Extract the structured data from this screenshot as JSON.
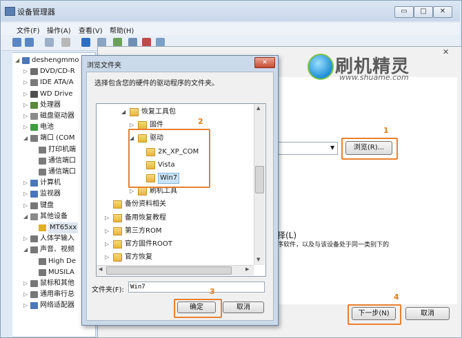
{
  "window": {
    "title": "设备管理器",
    "min": "▭",
    "max": "□",
    "close": "✕"
  },
  "menu": [
    "文件(F)",
    "操作(A)",
    "查看(V)",
    "帮助(H)"
  ],
  "tree": [
    {
      "label": "deshengmmo",
      "indent": 0,
      "exp": "◢",
      "icon": "#4a77b8"
    },
    {
      "label": "DVD/CD-R",
      "indent": 1,
      "exp": "▷",
      "icon": "#6d6d6d"
    },
    {
      "label": "IDE ATA/A",
      "indent": 1,
      "exp": "▷",
      "icon": "#7a7a7a"
    },
    {
      "label": "WD Drive",
      "indent": 1,
      "exp": "▷",
      "icon": "#4f4f4f"
    },
    {
      "label": "处理器",
      "indent": 1,
      "exp": "▷",
      "icon": "#5a8a3a"
    },
    {
      "label": "磁盘驱动器",
      "indent": 1,
      "exp": "▷",
      "icon": "#8a8a8a"
    },
    {
      "label": "电池",
      "indent": 1,
      "exp": "▷",
      "icon": "#3e9c3e"
    },
    {
      "label": "端口 (COM",
      "indent": 1,
      "exp": "◢",
      "icon": "#7b7b7b"
    },
    {
      "label": "打印机端",
      "indent": 2,
      "exp": "",
      "icon": "#7b7b7b"
    },
    {
      "label": "通信端口",
      "indent": 2,
      "exp": "",
      "icon": "#7b7b7b"
    },
    {
      "label": "通信端口",
      "indent": 2,
      "exp": "",
      "icon": "#7b7b7b"
    },
    {
      "label": "计算机",
      "indent": 1,
      "exp": "▷",
      "icon": "#4a77b8"
    },
    {
      "label": "监视器",
      "indent": 1,
      "exp": "▷",
      "icon": "#4a77b8"
    },
    {
      "label": "键盘",
      "indent": 1,
      "exp": "▷",
      "icon": "#777777"
    },
    {
      "label": "其他设备",
      "indent": 1,
      "exp": "◢",
      "icon": "#8a8a8a"
    },
    {
      "label": "MT65xx",
      "indent": 2,
      "exp": "",
      "icon": "#e0b020",
      "highlight": true
    },
    {
      "label": "人体学输入",
      "indent": 1,
      "exp": "▷",
      "icon": "#777777"
    },
    {
      "label": "声音、视频",
      "indent": 1,
      "exp": "◢",
      "icon": "#777777"
    },
    {
      "label": "High De",
      "indent": 2,
      "exp": "",
      "icon": "#777777"
    },
    {
      "label": "MUSILA",
      "indent": 2,
      "exp": "",
      "icon": "#777777"
    },
    {
      "label": "鼠标和其他",
      "indent": 1,
      "exp": "▷",
      "icon": "#777777"
    },
    {
      "label": "通用串行总",
      "indent": 1,
      "exp": "▷",
      "icon": "#777777"
    },
    {
      "label": "网络适配器",
      "indent": 1,
      "exp": "▷",
      "icon": "#4a77b8"
    }
  ],
  "logo": {
    "name": "刷机精灵",
    "url": "www.shuame.com"
  },
  "wizard": {
    "browse_button": "浏览(R)...",
    "desc_title_tail": "择(L)",
    "desc_line": "序软件，以及与该设备处于同一类别下的",
    "next_button": "下一步(N)",
    "cancel_button": "取消",
    "close": "✕"
  },
  "browse_dialog": {
    "title": "浏览文件夹",
    "close": "✕",
    "prompt": "选择包含您的硬件的驱动程序的文件夹。",
    "folder_label": "文件夹(F):",
    "folder_value": "Win7",
    "ok": "确定",
    "cancel": "取消",
    "folders": [
      {
        "name": "恢复工具包",
        "level": 0,
        "arrow": "◢"
      },
      {
        "name": "固件",
        "level": 1,
        "arrow": "▷"
      },
      {
        "name": "驱动",
        "level": 1,
        "arrow": "◢"
      },
      {
        "name": "2K_XP_COM",
        "level": 2,
        "arrow": ""
      },
      {
        "name": "Vista",
        "level": 2,
        "arrow": ""
      },
      {
        "name": "Win7",
        "level": 2,
        "arrow": "",
        "selected": true
      },
      {
        "name": "刷机工具",
        "level": 1,
        "arrow": "▷"
      },
      {
        "name": "备份资料相关",
        "level": -1,
        "arrow": ""
      },
      {
        "name": "备用恢复教程",
        "level": -1,
        "arrow": "▷"
      },
      {
        "name": "第三方ROM",
        "level": -1,
        "arrow": "▷"
      },
      {
        "name": "官方固件ROOT",
        "level": -1,
        "arrow": "▷"
      },
      {
        "name": "官方恢复",
        "level": -1,
        "arrow": "▷"
      }
    ]
  },
  "annotations": [
    "1",
    "2",
    "3",
    "4"
  ],
  "colors": {
    "accent_orange": "#e9802f",
    "selection": "#cce4f7"
  }
}
